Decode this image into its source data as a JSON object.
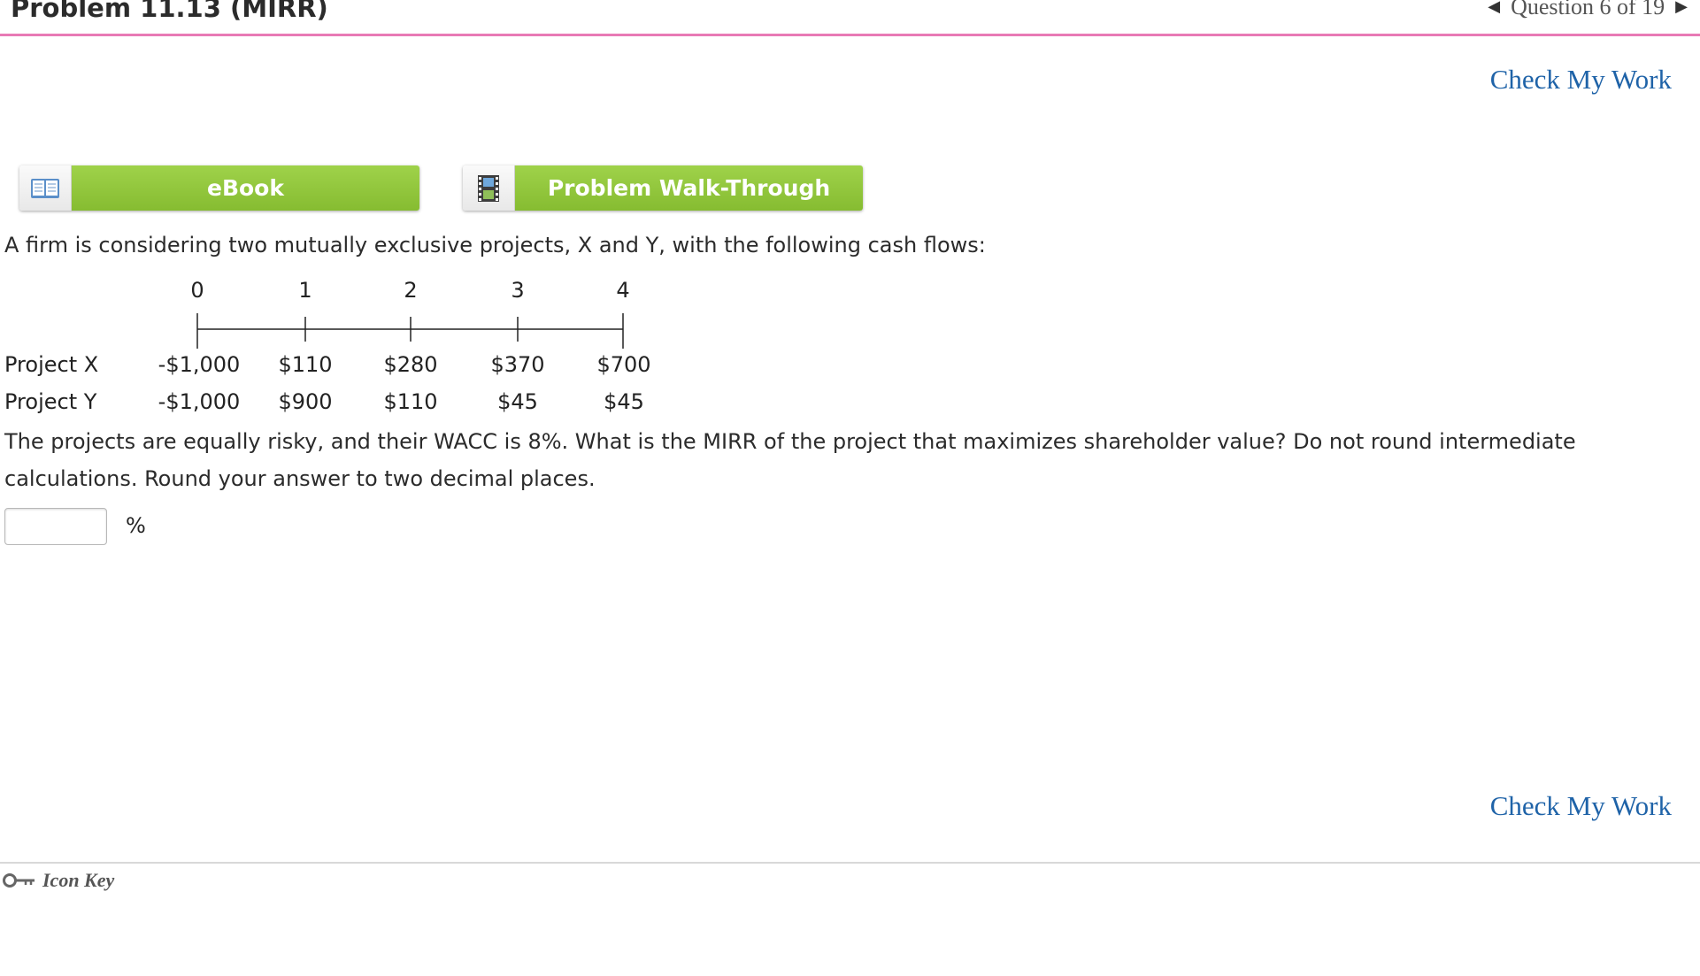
{
  "header": {
    "title": "Problem 11.13 (MIRR)",
    "question_nav": "Question 6 of 19"
  },
  "check_my_work": "Check My Work",
  "resources": {
    "ebook_label": "eBook",
    "walkthrough_label": "Problem Walk-Through"
  },
  "problem": {
    "intro": "A firm is considering two mutually exclusive projects, X and Y, with the following cash flows:",
    "timeline_periods": [
      "0",
      "1",
      "2",
      "3",
      "4"
    ],
    "projects": [
      {
        "label": "Project X",
        "cash_flows": [
          "-$1,000",
          "$110",
          "$280",
          "$370",
          "$700"
        ]
      },
      {
        "label": "Project Y",
        "cash_flows": [
          "-$1,000",
          "$900",
          "$110",
          "$45",
          "$45"
        ]
      }
    ],
    "question": "The projects are equally risky, and their WACC is 8%. What is the MIRR of the project that maximizes shareholder value? Do not round intermediate calculations. Round your answer to two decimal places."
  },
  "answer": {
    "value": "",
    "unit": "%"
  },
  "footer": {
    "icon_key_label": "Icon Key"
  },
  "colors": {
    "accent_pink": "#e87ab5",
    "button_green": "#8dc63f",
    "link_blue": "#1f63a8"
  }
}
